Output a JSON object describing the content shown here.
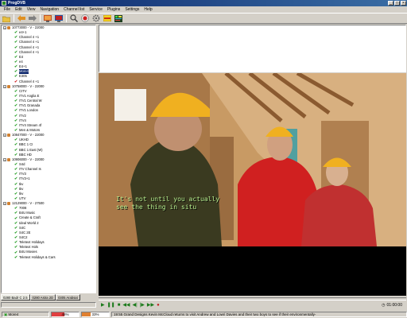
{
  "window": {
    "title": "ProgDVB",
    "buttons": [
      "_",
      "□",
      "×"
    ]
  },
  "menu": [
    "File",
    "Edit",
    "View",
    "Navigation",
    "Channel list",
    "Service",
    "Plugins",
    "Settings",
    "Help"
  ],
  "toolbar": {
    "icons": [
      "folder-icon",
      "back-icon",
      "forward-icon",
      "tv-icon",
      "monitor-icon",
      "search-icon",
      "record-icon",
      "settings-icon",
      "epg-icon",
      "teletext-icon"
    ]
  },
  "channel_tree": [
    {
      "type": "sat",
      "label": "10773000 - V - 22000"
    },
    {
      "type": "ch",
      "label": "e4+1",
      "color": "green"
    },
    {
      "type": "ch",
      "label": "Channel 4 +1",
      "color": "green"
    },
    {
      "type": "ch",
      "label": "Channel 4 +1",
      "color": "green"
    },
    {
      "type": "ch",
      "label": "Channel 4 +1",
      "color": "green"
    },
    {
      "type": "ch",
      "label": "Channel 4 +1",
      "color": "green"
    },
    {
      "type": "ch",
      "label": "E4",
      "color": "green"
    },
    {
      "type": "ch",
      "label": "e4",
      "color": "green"
    },
    {
      "type": "ch",
      "label": "E4+1",
      "color": "green"
    },
    {
      "type": "ch",
      "label": "More4",
      "color": "green",
      "selected": true
    },
    {
      "type": "ch",
      "label": "E305",
      "color": "green"
    },
    {
      "type": "ch",
      "label": "Channel 4 +1",
      "color": "red"
    },
    {
      "type": "sat",
      "label": "10758000 - V - 22000"
    },
    {
      "type": "ch",
      "label": "CITV",
      "color": "green"
    },
    {
      "type": "ch",
      "label": "ITV1 Anglia E",
      "color": "green"
    },
    {
      "type": "ch",
      "label": "ITV1 Central W",
      "color": "green"
    },
    {
      "type": "ch",
      "label": "ITV1 Granada",
      "color": "green"
    },
    {
      "type": "ch",
      "label": "ITV1 London",
      "color": "green"
    },
    {
      "type": "ch",
      "label": "ITV2",
      "color": "green"
    },
    {
      "type": "ch",
      "label": "ITV4",
      "color": "green"
    },
    {
      "type": "ch",
      "label": "ITV4 Stream 4f",
      "color": "green"
    },
    {
      "type": "ch",
      "label": "Men & Motors",
      "color": "green"
    },
    {
      "type": "sat",
      "label": "10847000 - V - 22000"
    },
    {
      "type": "ch",
      "label": "UKHD",
      "color": "green"
    },
    {
      "type": "ch",
      "label": "BBC 1 CI",
      "color": "green"
    },
    {
      "type": "ch",
      "label": "BBC 1 East (W)",
      "color": "green"
    },
    {
      "type": "ch",
      "label": "BBC HD",
      "color": "green"
    },
    {
      "type": "sat",
      "label": "10906000 - V - 22000"
    },
    {
      "type": "ch",
      "label": "S4d",
      "color": "green"
    },
    {
      "type": "ch",
      "label": "ITV Channel Is",
      "color": "green"
    },
    {
      "type": "ch",
      "label": "ITV3",
      "color": "green"
    },
    {
      "type": "ch",
      "label": "ITV3+1",
      "color": "green"
    },
    {
      "type": "ch",
      "label": "tkv",
      "color": "green"
    },
    {
      "type": "ch",
      "label": "tkv",
      "color": "green"
    },
    {
      "type": "ch",
      "label": "tkv",
      "color": "green"
    },
    {
      "type": "ch",
      "label": "UTV",
      "color": "green"
    },
    {
      "type": "sat",
      "label": "12129000 - V - 27500"
    },
    {
      "type": "ch",
      "label": "7008",
      "color": "green"
    },
    {
      "type": "ch",
      "label": "B4U Music",
      "color": "green"
    },
    {
      "type": "ch",
      "label": "Create & Craft",
      "color": "green"
    },
    {
      "type": "ch",
      "label": "Ideal World 2",
      "color": "green"
    },
    {
      "type": "ch",
      "label": "S4C",
      "color": "green"
    },
    {
      "type": "ch",
      "label": "S4C 2E",
      "color": "green"
    },
    {
      "type": "ch",
      "label": "S4C2",
      "color": "green"
    },
    {
      "type": "ch",
      "label": "Teletext Holidays",
      "color": "green"
    },
    {
      "type": "ch",
      "label": "Teletext Hols",
      "color": "green"
    },
    {
      "type": "ch",
      "label": "B4U Movies",
      "color": "green"
    },
    {
      "type": "ch",
      "label": "Teletext Holidays & Cars",
      "color": "green"
    }
  ],
  "tabs": [
    "0280",
    "Badr C 2.5",
    "0280",
    "Astra 2D",
    "0305",
    "Arabsat"
  ],
  "video": {
    "subtitle_line1": "It's not until you actually",
    "subtitle_line2": "see the thing in situ"
  },
  "playback": {
    "time": "01:00:00",
    "controls": [
      "play",
      "pause",
      "stop",
      "rewind",
      "fast-rewind",
      "fast-forward",
      "forward",
      "record"
    ]
  },
  "status": {
    "channel": "More4",
    "level_pct": "48%",
    "quality_pct": "33%",
    "level_value": 0.48,
    "quality_value": 0.33,
    "epg_text": "19:55 Grand Designs Kevin McCloud returns to visit Andrew and Lowri Davies and their two boys to see if their environmentally-",
    "colors": {
      "level": "#e04040",
      "quality": "#e08030"
    }
  }
}
